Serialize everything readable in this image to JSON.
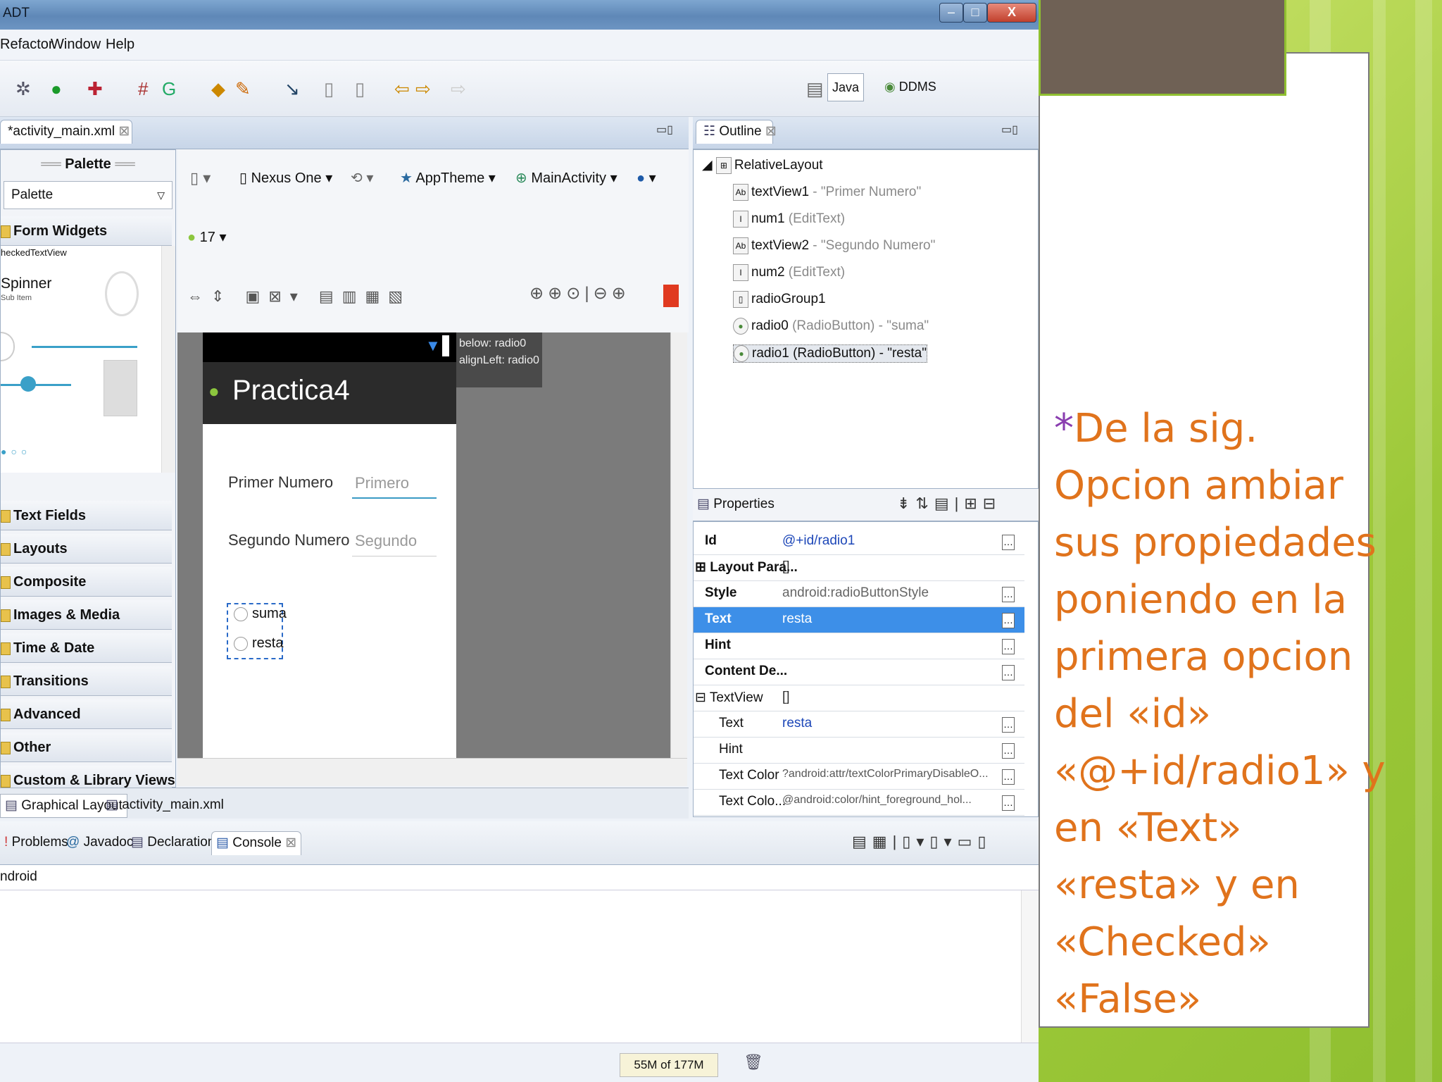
{
  "window": {
    "title": "ADT",
    "minimize": "–",
    "maximize": "□",
    "close": "X"
  },
  "menu": [
    "Refactor",
    "Window",
    "Help"
  ],
  "perspectives": {
    "java": "Java",
    "ddms": "DDMS"
  },
  "editor": {
    "tab": "*activity_main.xml",
    "palette_header": "Palette",
    "palette_dropdown": "Palette",
    "categories": [
      "Form Widgets",
      "Text Fields",
      "Layouts",
      "Composite",
      "Images & Media",
      "Time & Date",
      "Transitions",
      "Advanced",
      "Other",
      "Custom & Library Views"
    ],
    "widget_checked": "heckedTextView",
    "widget_spinner": "Spinner",
    "widget_spinner_sub": "Sub Item",
    "device": "Nexus One",
    "theme": "AppTheme",
    "activity": "MainActivity",
    "api": "17",
    "tooltip_line1": "below: radio0",
    "tooltip_line2": "alignLeft: radio0",
    "app_title": "Practica4",
    "label1": "Primer Numero",
    "hint1": "Primero",
    "label2": "Segundo Numero",
    "hint2": "Segundo",
    "radio0": "suma",
    "radio1": "resta",
    "bottom_tabs": [
      "Graphical Layout",
      "activity_main.xml"
    ]
  },
  "outline": {
    "tab": "Outline",
    "root": "RelativeLayout",
    "items": [
      {
        "name": "textView1",
        "detail": " - \"Primer Numero\""
      },
      {
        "name": "num1",
        "detail": " (EditText)"
      },
      {
        "name": "textView2",
        "detail": " - \"Segundo Numero\""
      },
      {
        "name": "num2",
        "detail": " (EditText)"
      },
      {
        "name": "radioGroup1",
        "detail": ""
      },
      {
        "name": "radio0",
        "detail": " (RadioButton) - \"suma\""
      },
      {
        "name": "radio1 (RadioButton) - \"resta\"",
        "detail": ""
      }
    ]
  },
  "properties": {
    "tab": "Properties",
    "rows": [
      {
        "key": "Id",
        "value": "@+id/radio1"
      },
      {
        "key": "⊞ Layout Para...",
        "value": "[]"
      },
      {
        "key": "Style",
        "value": "android:radioButtonStyle"
      },
      {
        "key": "Text",
        "value": "resta"
      },
      {
        "key": "Hint",
        "value": ""
      },
      {
        "key": "Content De...",
        "value": ""
      },
      {
        "key": "⊟ TextView",
        "value": "[]"
      },
      {
        "key": "Text",
        "value": "resta"
      },
      {
        "key": "Hint",
        "value": ""
      },
      {
        "key": "Text Color",
        "value": "?android:attr/textColorPrimaryDisableO..."
      },
      {
        "key": "Text Colo...",
        "value": "@android:color/hint_foreground_hol..."
      }
    ]
  },
  "console": {
    "tabs": [
      "Problems",
      "Javadoc",
      "Declaration",
      "Console"
    ],
    "line": "ndroid",
    "memory": "55M of 177M"
  },
  "slide": {
    "star": "*",
    "text": "De la sig.\nOpcion ambiar\nsus propiedades\nponiendo en la\nprimera opcion\ndel «id»\n«@+id/radio1» y\nen «Text»\n«resta» y en\n«Checked»\n«False»"
  },
  "colors": {
    "accent": "#3d8fe8",
    "slide_text": "#e0731c",
    "slide_bg": "#9cc838"
  }
}
